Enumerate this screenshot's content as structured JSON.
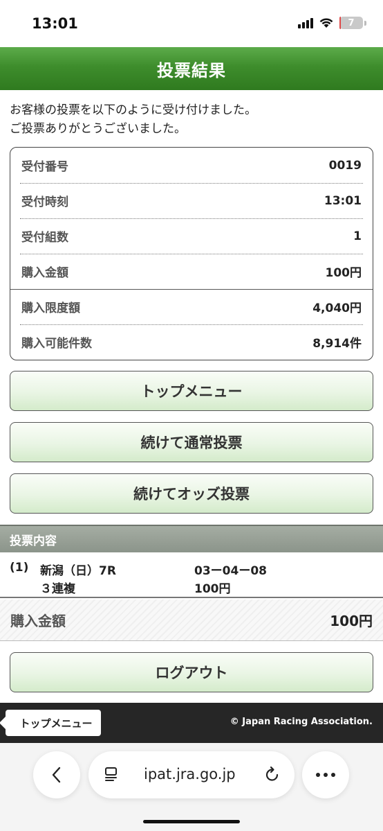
{
  "status_bar": {
    "time": "13:01",
    "battery": "7"
  },
  "header": {
    "title": "投票結果"
  },
  "intro": {
    "line1": "お客様の投票を以下のように受け付けました。",
    "line2": "ご投票ありがとうございました。"
  },
  "info": [
    {
      "label": "受付番号",
      "value": "0019"
    },
    {
      "label": "受付時刻",
      "value": "13:01"
    },
    {
      "label": "受付組数",
      "value": "1"
    },
    {
      "label": "購入金額",
      "value": "100円"
    },
    {
      "label": "購入限度額",
      "value": "4,040円"
    },
    {
      "label": "購入可能件数",
      "value": "8,914件"
    }
  ],
  "buttons": {
    "top_menu": "トップメニュー",
    "continue_normal": "続けて通常投票",
    "continue_odds": "続けてオッズ投票",
    "logout": "ログアウト"
  },
  "bet_section": {
    "heading": "投票内容",
    "index": "(1)",
    "race": "新潟（日）7R",
    "combination": "03ー04ー08",
    "bet_type": "３連複",
    "amount": "100円"
  },
  "total": {
    "label": "購入金額",
    "value": "100円"
  },
  "footer": {
    "top_menu": "トップメニュー",
    "copyright": "© Japan Racing Association."
  },
  "browser": {
    "url": "ipat.jra.go.jp"
  }
}
